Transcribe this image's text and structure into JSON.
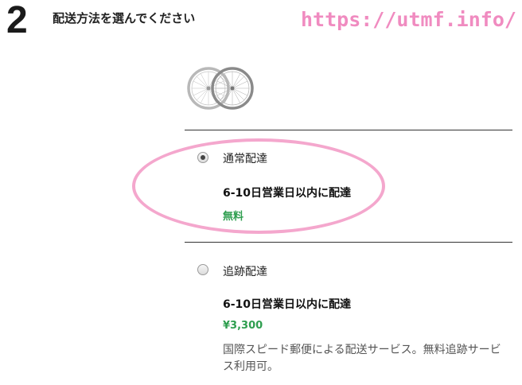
{
  "step": {
    "number": "2",
    "title": "配送方法を選んでください"
  },
  "watermark": {
    "text": "https://utmf.info/",
    "color": "#f08bc0"
  },
  "product": {
    "icon": "bicycle-wheels-icon"
  },
  "options": [
    {
      "name": "通常配達",
      "delivery_time": "6-10日営業日以内に配達",
      "price": "無料",
      "selected": true
    },
    {
      "name": "追跡配達",
      "delivery_time": "6-10日営業日以内に配達",
      "price": "¥3,300",
      "description": "国際スピード郵便による配送サービス。無料追跡サービス利用可。",
      "selected": false
    }
  ],
  "colors": {
    "price": "#2e9e4f",
    "highlight": "#f4a7cd"
  }
}
